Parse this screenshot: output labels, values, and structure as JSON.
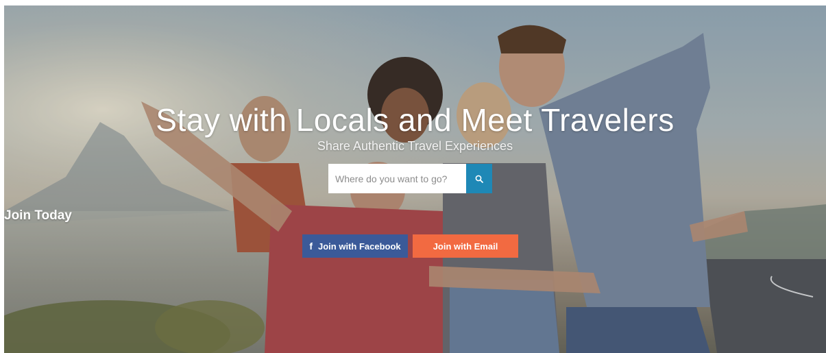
{
  "hero": {
    "headline": "Stay with Locals and Meet Travelers",
    "subheadline": "Share Authentic Travel Experiences",
    "image_subject": "group of friends celebrating by the coast at sunset"
  },
  "search": {
    "placeholder": "Where do you want to go?",
    "value": "",
    "button_icon": "search-icon"
  },
  "join": {
    "title": "Join Today",
    "facebook_label": "Join with Facebook",
    "facebook_icon": "facebook-icon",
    "email_label": "Join with Email"
  },
  "colors": {
    "search_button": "#1e88b6",
    "facebook": "#3b5a99",
    "email": "#f26a41"
  }
}
